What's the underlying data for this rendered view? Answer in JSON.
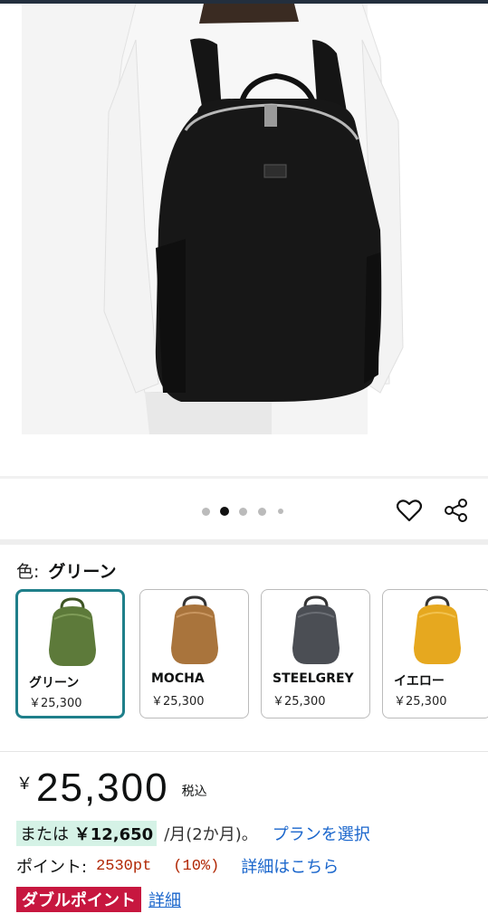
{
  "carousel": {
    "dots": 5,
    "active_index": 1
  },
  "actions": {
    "favorite_icon": "heart-icon",
    "share_icon": "share-icon"
  },
  "color": {
    "label": "色:",
    "selected": "グリーン"
  },
  "variants": [
    {
      "name": "グリーン",
      "price": "￥25,300",
      "color": "#5d7a3a",
      "selected": true
    },
    {
      "name": "MOCHA",
      "price": "￥25,300",
      "color": "#a9743c",
      "selected": false
    },
    {
      "name": "STEELGREY",
      "price": "￥25,300",
      "color": "#4b4e54",
      "selected": false
    },
    {
      "name": "イエロー",
      "price": "￥25,300",
      "color": "#e6a81f",
      "selected": false
    }
  ],
  "price": {
    "symbol": "￥",
    "amount": "25,300",
    "tax_label": "税込"
  },
  "plan": {
    "prefix": "または",
    "amount": "￥12,650",
    "suffix": "/月(2か月)。",
    "link": "プランを選択"
  },
  "points": {
    "label": "ポイント:",
    "value": "2530pt",
    "percent": "(10%)",
    "link": "詳細はこちら"
  },
  "double_point": {
    "badge": "ダブルポイント",
    "link": "詳細"
  },
  "colors": {
    "accent_teal": "#1f7f8a",
    "link_blue": "#1a66cc",
    "price_red": "#b12704",
    "badge_red": "#c7173f",
    "plan_highlight": "#d5f2e6"
  }
}
